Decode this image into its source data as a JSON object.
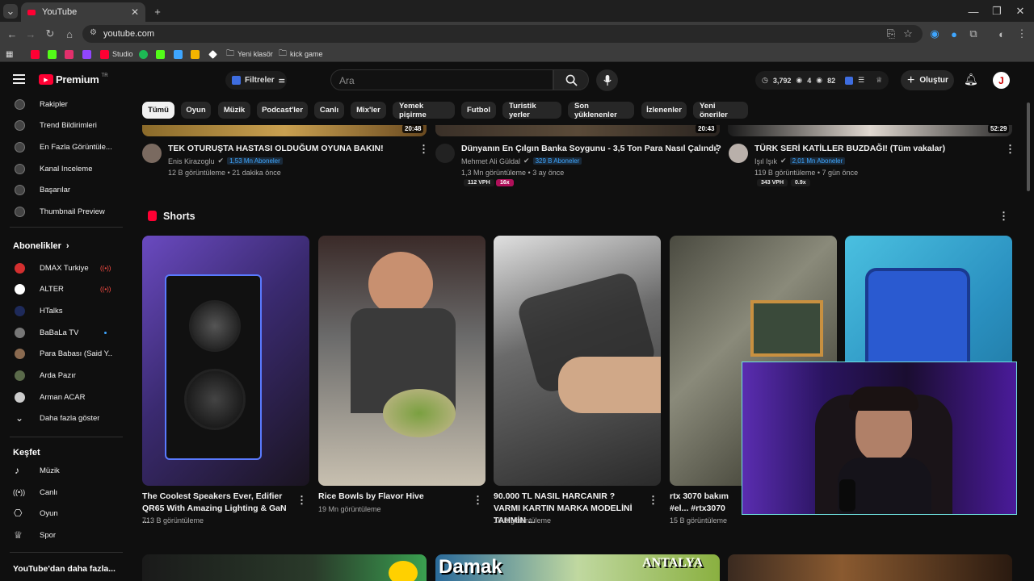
{
  "browser": {
    "tab_title": "YouTube",
    "url": "youtube.com",
    "bookmarks": [
      {
        "label": "",
        "color": "#ff0033"
      },
      {
        "label": "",
        "color": "#53fc18"
      },
      {
        "label": "",
        "color": "#e1306c"
      },
      {
        "label": "",
        "color": "#9146ff"
      },
      {
        "label": "Studio",
        "color": "#ff0033"
      },
      {
        "label": "",
        "color": "#1db954"
      },
      {
        "label": "",
        "color": "#53fc18"
      },
      {
        "label": "",
        "color": "#3ea6ff"
      },
      {
        "label": "",
        "color": "#f4b400"
      },
      {
        "label": "",
        "color": "#ffffff"
      },
      {
        "label": "Yeni klasör",
        "color": "#bbbbbb"
      },
      {
        "label": "kick game",
        "color": "#bbbbbb"
      }
    ]
  },
  "masthead": {
    "logo": "Premium",
    "region": "TR",
    "filter_label": "Filtreler",
    "search_placeholder": "Ara",
    "stat_1": "3,792",
    "stat_2": "4",
    "stat_3": "82",
    "create_label": "Oluştur",
    "avatar_letter": "J"
  },
  "sidebar": {
    "tools": [
      "Rakipler",
      "Trend Bildirimleri",
      "En Fazla Görüntüle...",
      "Kanal Inceleme",
      "Başarılar",
      "Thumbnail Preview"
    ],
    "subs_header": "Abonelikler",
    "subs": [
      {
        "name": "DMAX Turkiye",
        "live": true,
        "dot": false,
        "color": "#d32f2f"
      },
      {
        "name": "ALTER",
        "live": true,
        "dot": false,
        "color": "#ffffff"
      },
      {
        "name": "HTalks",
        "live": false,
        "dot": false,
        "color": "#1e2a5a"
      },
      {
        "name": "BaBaLa TV",
        "live": false,
        "dot": true,
        "color": "#777777"
      },
      {
        "name": "Para Babası (Said Y...",
        "live": false,
        "dot": false,
        "color": "#8a6a50"
      },
      {
        "name": "Arda Pazır",
        "live": false,
        "dot": false,
        "color": "#5a6a4a"
      },
      {
        "name": "Arman ACAR",
        "live": false,
        "dot": false,
        "color": "#cccccc"
      }
    ],
    "show_more": "Daha fazla göster",
    "explore_header": "Keşfet",
    "explore": [
      "Müzik",
      "Canlı",
      "Oyun",
      "Spor"
    ],
    "more_header": "YouTube'dan daha fazla..."
  },
  "chips": [
    "Tümü",
    "Oyun",
    "Müzik",
    "Podcast'ler",
    "Canlı",
    "Mix'ler",
    "Yemek pişirme",
    "Futbol",
    "Turistik yerler",
    "Son yüklenenler",
    "İzlenenler",
    "Yeni öneriler"
  ],
  "videos": [
    {
      "duration": "20:48",
      "title": "TEK OTURUŞTA HASTASI OLDUĞUM OYUNA BAKIN!",
      "channel": "Enis Kirazoglu",
      "subs": "1,53 Mn Aboneler",
      "meta": "12 B görüntüleme • 21 dakika önce",
      "vph": "",
      "ratio": ""
    },
    {
      "duration": "20:43",
      "title": "Dünyanın En Çılgın Banka Soygunu - 3,5 Ton Para Nasıl Çalındı?",
      "channel": "Mehmet Ali Güldal",
      "subs": "329 B Aboneler",
      "meta": "1,3 Mn görüntüleme • 3 ay önce",
      "vph": "112 VPH",
      "ratio": "16x"
    },
    {
      "duration": "52:29",
      "title": "TÜRK SERİ KATİLLER BUZDAĞI! (Tüm vakalar)",
      "channel": "Işıl Işık",
      "subs": "2,01 Mn Aboneler",
      "meta": "119 B görüntüleme • 7 gün önce",
      "vph": "343 VPH",
      "ratio": "0.9x"
    }
  ],
  "shorts_header": "Shorts",
  "shorts": [
    {
      "title": "The Coolest Speakers Ever, Edifier QR65 With Amazing Lighting & GaN ...",
      "views": "713 B görüntüleme"
    },
    {
      "title": "Rice Bowls by Flavor Hive",
      "views": "19 Mn görüntüleme"
    },
    {
      "title": "90.000 TL NASIL HARCANIR ? VARMI KARTIN MARKA MODELİNİ TAHMİN ...",
      "views": "18 B görüntüleme"
    },
    {
      "title": "rtx 3070 bakım #el... #rtx3070",
      "views": "15 B görüntüleme"
    },
    {
      "title": "",
      "views": ""
    }
  ],
  "bottom_row": [
    "",
    "Damak",
    "ANTALYA",
    ""
  ]
}
